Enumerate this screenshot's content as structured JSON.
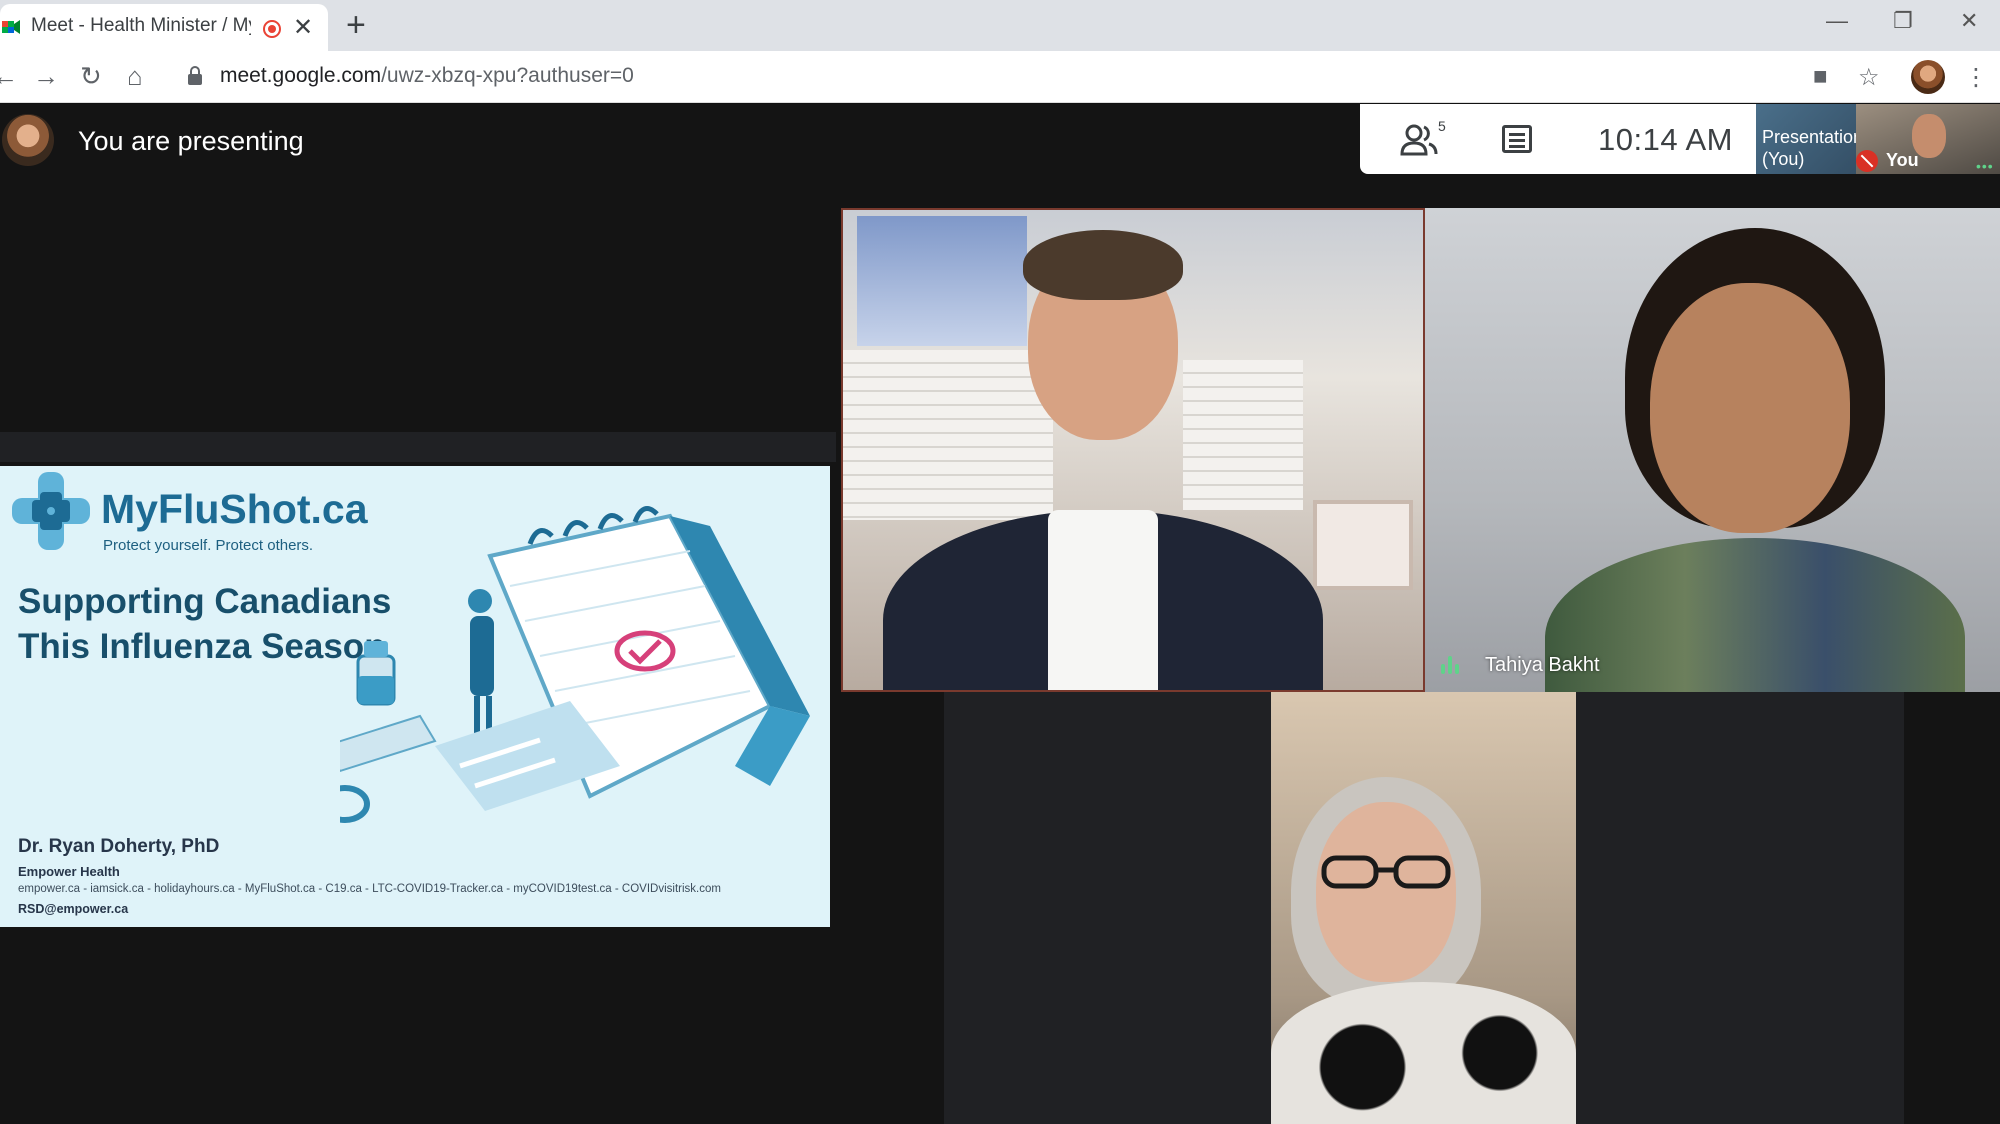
{
  "browser": {
    "tab_title": "Meet - Health Minister / MyF",
    "close_glyph": "✕",
    "new_tab_glyph": "+",
    "url_host": "meet.google.com",
    "url_path": "/uwz-xbzq-xpu?authuser=0",
    "window_controls": [
      "—",
      "❐",
      "✕"
    ],
    "nav": {
      "back": "←",
      "forward": "→",
      "reload": "↻",
      "home": "⌂"
    },
    "toolbar_icons": [
      "camera-icon",
      "star-icon",
      "menu-icon"
    ],
    "glyphs": {
      "camera": "■",
      "star": "☆",
      "menu": "⋮"
    }
  },
  "meet": {
    "presenting_text": "You are presenting",
    "people_count": "5",
    "time": "10:14  AM",
    "mini_tiles": {
      "presentation_label": "Presentation (You)",
      "you_label": "You",
      "dots": "•••"
    },
    "participants": [
      {
        "name": "",
        "speaking": false
      },
      {
        "name": "Tahiya Bakht",
        "speaking": true
      },
      {
        "name": "",
        "speaking": false
      }
    ],
    "colors": {
      "accent_green": "#5fd38a",
      "mute_red": "#d93025",
      "rec_red": "#ea4335"
    }
  },
  "slide": {
    "brand": "MyFluShot.ca",
    "tagline": "Protect yourself. Protect others.",
    "headline_line1": "Supporting Canadians",
    "headline_line2": "This Influenza Season",
    "author": "Dr. Ryan Doherty, PhD",
    "org": "Empower Health",
    "sites": "empower.ca - iamsick.ca - holidayhours.ca - MyFluShot.ca - C19.ca - LTC-COVID19-Tracker.ca - myCOVID19test.ca - COVIDvisitrisk.com",
    "contact": "RSD@empower.ca"
  }
}
